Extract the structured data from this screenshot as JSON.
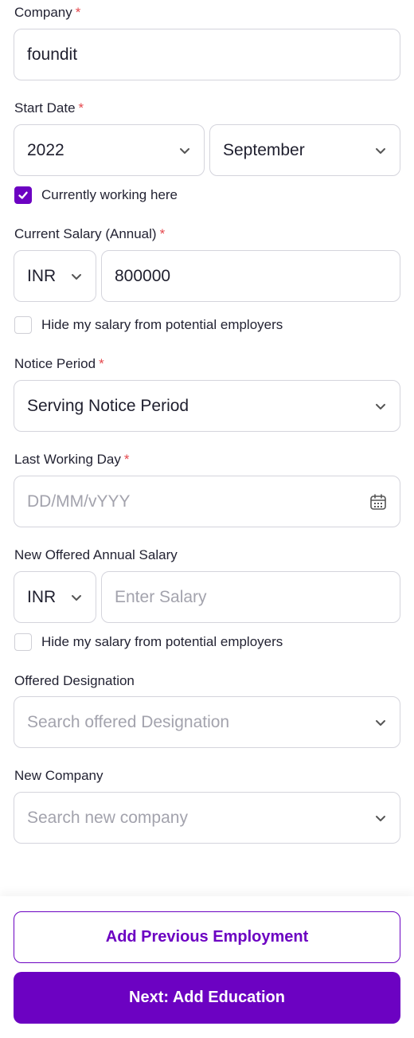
{
  "company": {
    "label": "Company",
    "value": "foundit"
  },
  "start_date": {
    "label": "Start Date",
    "year": "2022",
    "month": "September"
  },
  "currently_working": {
    "label": "Currently working here",
    "checked": true
  },
  "current_salary": {
    "label": "Current Salary (Annual)",
    "currency": "INR",
    "value": "800000"
  },
  "hide_salary_1": {
    "label": "Hide my salary from potential employers",
    "checked": false
  },
  "notice_period": {
    "label": "Notice Period",
    "value": "Serving Notice Period"
  },
  "last_working_day": {
    "label": "Last Working Day",
    "placeholder": "DD/MM/vYYY"
  },
  "new_salary": {
    "label": "New Offered Annual Salary",
    "currency": "INR",
    "placeholder": "Enter Salary"
  },
  "hide_salary_2": {
    "label": "Hide my salary from potential employers",
    "checked": false
  },
  "offered_designation": {
    "label": "Offered Designation",
    "placeholder": "Search offered Designation"
  },
  "new_company": {
    "label": "New Company",
    "placeholder": "Search new company"
  },
  "required_mark": "*",
  "buttons": {
    "add_previous": "Add Previous Employment",
    "next": "Next: Add Education"
  },
  "colors": {
    "accent": "#6c02c2",
    "required": "#e5484d"
  },
  "icons": {
    "chevron": "chevron-down-icon",
    "calendar": "calendar-icon",
    "check": "check-icon"
  }
}
